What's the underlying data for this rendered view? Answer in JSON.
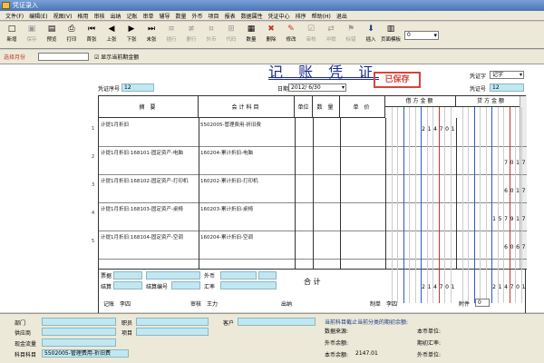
{
  "window": {
    "title": "凭证录入"
  },
  "menu": [
    "文件(F)",
    "编辑(E)",
    "视图(V)",
    "格用",
    "审核",
    "出纳",
    "记账",
    "审单",
    "辅导",
    "数量",
    "外币",
    "项目",
    "报表",
    "数据属性",
    "凭证中心",
    "排序",
    "帮助(H)",
    "退出"
  ],
  "toolbar": [
    {
      "label": "新增",
      "icon": "new-icon",
      "glyph": "□",
      "enabled": true
    },
    {
      "label": "保存",
      "icon": "save-icon",
      "glyph": "▣",
      "enabled": false
    },
    {
      "label": "预览",
      "icon": "preview-icon",
      "glyph": "▤",
      "enabled": true
    },
    {
      "label": "打印",
      "icon": "print-icon",
      "glyph": "⎙",
      "enabled": true
    },
    {
      "label": "首张",
      "icon": "first-icon",
      "glyph": "⏮",
      "enabled": true
    },
    {
      "label": "上张",
      "icon": "prev-icon",
      "glyph": "◀",
      "enabled": true
    },
    {
      "label": "下张",
      "icon": "next-icon",
      "glyph": "▶",
      "enabled": true
    },
    {
      "label": "末张",
      "icon": "last-icon",
      "glyph": "⏭",
      "enabled": true
    },
    {
      "label": "插行",
      "icon": "insert-row-icon",
      "glyph": "≡",
      "enabled": false
    },
    {
      "label": "删行",
      "icon": "delete-row-icon",
      "glyph": "≢",
      "enabled": false
    },
    {
      "label": "外币",
      "icon": "currency-icon",
      "glyph": "¤",
      "enabled": false
    },
    {
      "label": "代码",
      "icon": "code-icon",
      "glyph": "⊞",
      "enabled": false
    },
    {
      "label": "数量",
      "icon": "quantity-icon",
      "glyph": "▦",
      "enabled": true
    },
    {
      "label": "删除",
      "icon": "delete-icon",
      "glyph": "✖",
      "enabled": true
    },
    {
      "label": "修改",
      "icon": "edit-icon",
      "glyph": "✎",
      "enabled": true
    },
    {
      "label": "审核",
      "icon": "audit-icon",
      "glyph": "☑",
      "enabled": false
    },
    {
      "label": "冲销",
      "icon": "reverse-icon",
      "glyph": "⇄",
      "enabled": false
    },
    {
      "label": "标错",
      "icon": "mark-error-icon",
      "glyph": "⚑",
      "enabled": false
    },
    {
      "label": "插入",
      "icon": "insert-icon",
      "glyph": "⬇",
      "enabled": true
    },
    {
      "label": "页面模板",
      "icon": "template-icon",
      "glyph": "▥",
      "enabled": true
    }
  ],
  "toolbar_select": "0",
  "top": {
    "period_label": "选择月份",
    "period_value": "",
    "show_cur_label": "显示当前期金额",
    "voucher_word_label": "凭证字",
    "voucher_word_value": "记字",
    "voucher_no_label": "凭证号",
    "voucher_no_value": "12",
    "doc_no_label": "凭证序号",
    "doc_no_value": "12",
    "date_label": "日期",
    "date_value": "2012/ 6/30"
  },
  "voucher": {
    "title": "记 账 凭 证",
    "stamp": "已保存",
    "col_summary": "摘 要",
    "col_account": "会计科目",
    "col_unit": "单位",
    "col_qty": "数 量",
    "col_price": "单 价",
    "col_debit": "借方金额",
    "col_credit": "贷方金额",
    "rows": [
      {
        "summary": "计提1月折旧",
        "account": "5502005-管理费用-折旧费",
        "debit": "214701",
        "credit": ""
      },
      {
        "summary": "计提1月折旧:168101-固定资产-电脑",
        "account": "160204-累计折旧-电脑",
        "debit": "",
        "credit": "7017"
      },
      {
        "summary": "计提1月折旧:168102-固定资产-打印机",
        "account": "160202-累计折旧-打印机",
        "debit": "",
        "credit": "6017"
      },
      {
        "summary": "计提1月折旧:168103-固定资产-桌椅",
        "account": "160203-累计折旧-桌椅",
        "debit": "",
        "credit": "157917"
      },
      {
        "summary": "计提1月折旧:168104-固定资产-空调",
        "account": "160204-累计折旧-空调",
        "debit": "",
        "credit": "6067"
      }
    ],
    "total_label": "合 计",
    "total_debit": "214701",
    "total_credit": "214701",
    "ticket_label": "票据",
    "settle_label": "结算",
    "foreign_label": "外币",
    "rate_label": "汇率",
    "line_no_label": "结算编号",
    "bookkeeper_label": "记账",
    "bookkeeper": "李四",
    "auditor_label": "审核",
    "auditor": "王力",
    "cashier_label": "出纳",
    "maker_label": "制单",
    "maker": "李四",
    "attach_label": "附件",
    "attach_value": "0"
  },
  "bottom": {
    "dept_label": "部门",
    "staff_label": "职员",
    "customer_label": "客户",
    "supplier_label": "供应商",
    "project_label": "项目",
    "cash_label": "现金流量",
    "account_label": "科目科目",
    "account_value": "5502005-管理费用-折旧费",
    "hint": "当前科目截止当前分类的期初余额:",
    "unit1_label": "数据来源:",
    "unit2_label": "本币单位:",
    "unit3_label": "外币余额:",
    "unit4_label": "期初汇率:",
    "amount_label": "本币余额:",
    "amount_value": "2147.01",
    "unit5_label": "外币单位:"
  }
}
